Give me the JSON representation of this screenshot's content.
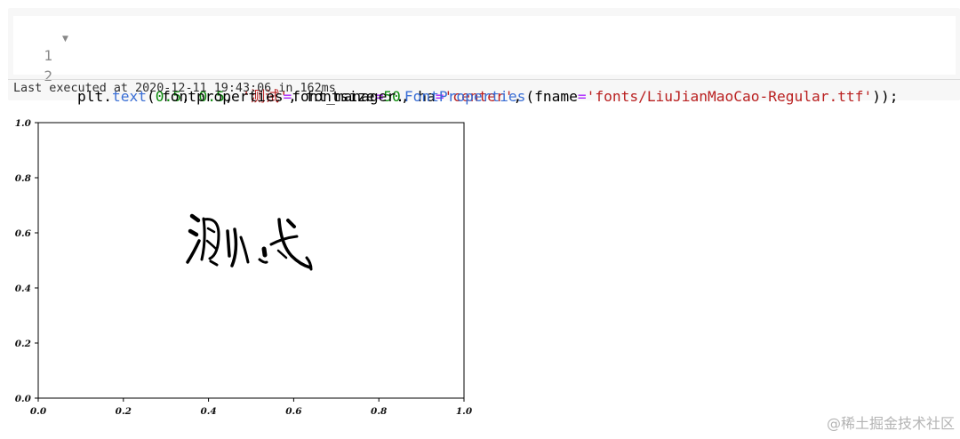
{
  "cell": {
    "lines": [
      {
        "number": "1",
        "fold_icon": "triangle-down-icon"
      },
      {
        "number": "2"
      }
    ],
    "code_line_1": {
      "p1": "plt.",
      "func": "text",
      "p2": "(",
      "n1": "0.5",
      "p3": ", ",
      "n2": "0.5",
      "p4": ", ",
      "s1": "'测试'",
      "p5": ", fontsize",
      "eq1": "=",
      "n3": "50",
      "p6": ", ha",
      "eq2": "=",
      "s2": "'center'",
      "p7": ","
    },
    "code_line_2": {
      "kw": "fontproperties",
      "eq": "=",
      "p1": "font_manager.",
      "cls": "FontProperties",
      "p2": "(fname",
      "eq2": "=",
      "s1": "'fonts/LiuJianMaoCao-Regular.ttf'",
      "p3": "));"
    },
    "exec_info": "Last executed at 2020-12-11 19:43:06 in 162ms"
  },
  "output_plot": {
    "x_ticks": [
      "0.0",
      "0.2",
      "0.4",
      "0.6",
      "0.8",
      "1.0"
    ],
    "y_ticks": [
      "0.0",
      "0.2",
      "0.4",
      "0.6",
      "0.8",
      "1.0"
    ],
    "text": "测试",
    "text_color": "#000000"
  },
  "watermark": "@稀土掘金技术社区"
}
